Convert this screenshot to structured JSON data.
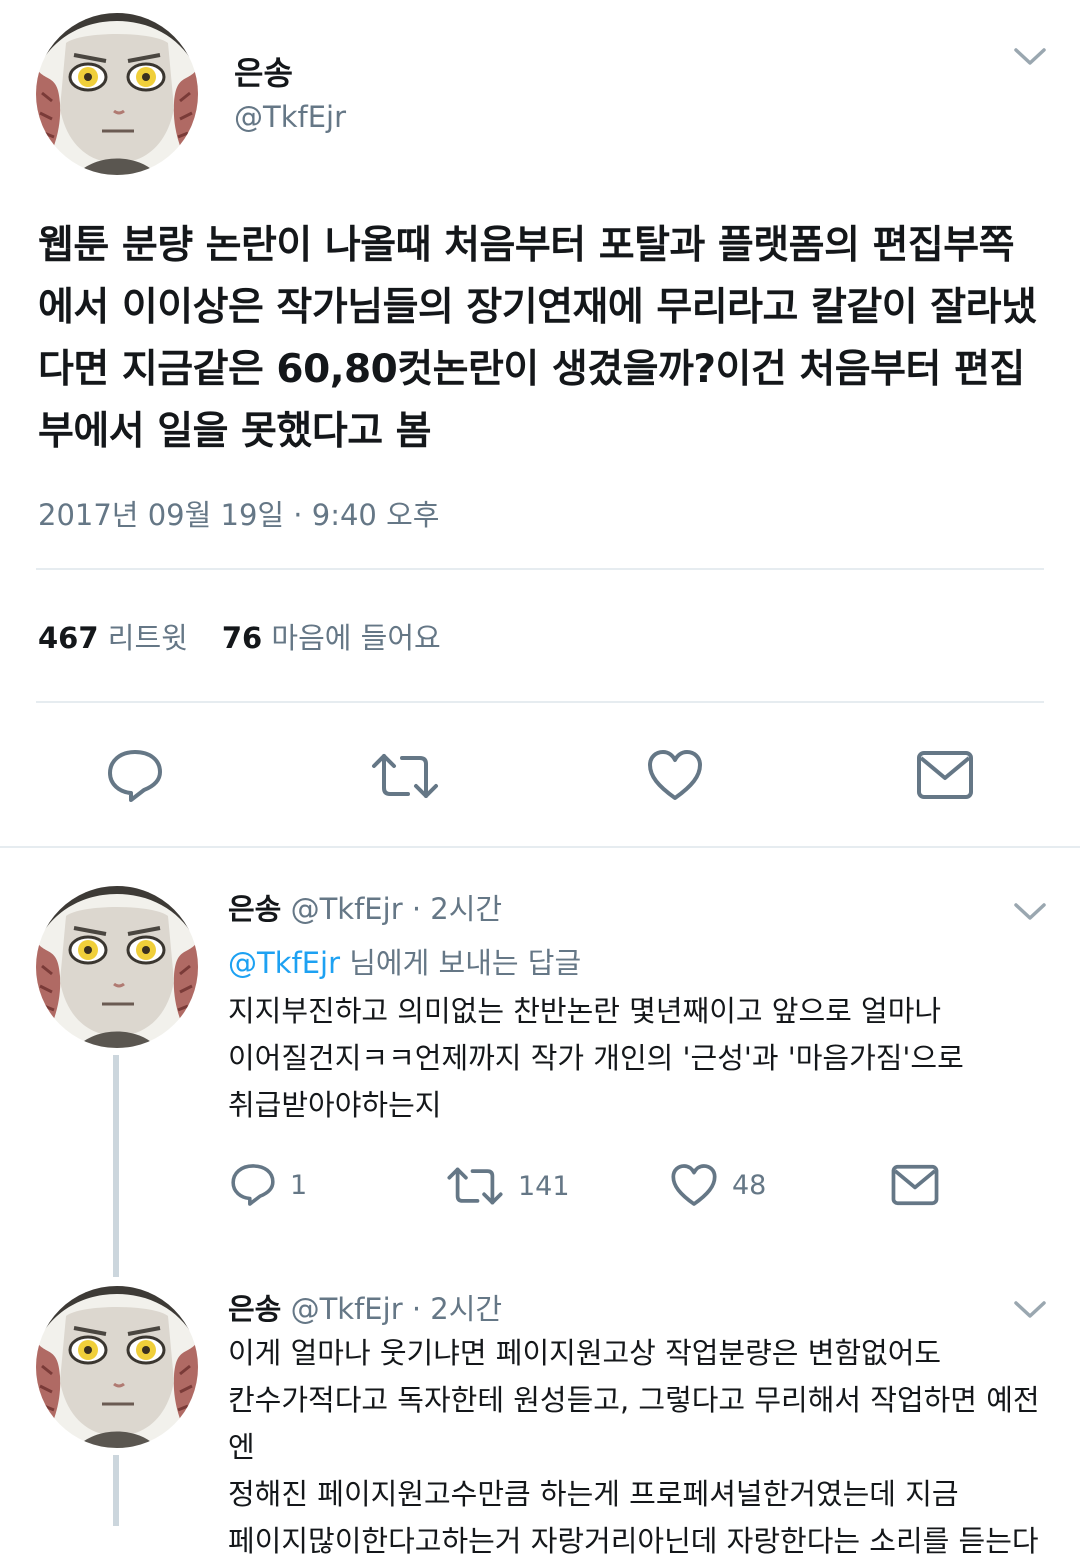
{
  "colors": {
    "accent": "#1da1f2",
    "text": "#14171a",
    "secondary": "#657786",
    "divider": "#e6ecf0"
  },
  "main_tweet": {
    "name": "은송",
    "handle": "@TkfEjr",
    "body": "웹툰 분량 논란이 나올때 처음부터 포탈과 플랫폼의 편집부쪽에서 이이상은 작가님들의 장기연재에 무리라고 칼같이 잘라냈다면 지금같은 60,80컷논란이 생겼을까?이건 처음부터 편집부에서 일을 못했다고 봄",
    "timestamp": "2017년 09월 19일 · 9:40 오후",
    "retweets_count": "467",
    "retweets_label": "리트윗",
    "likes_count": "76",
    "likes_label": "마음에 들어요",
    "icons": {
      "reply": "reply-icon",
      "retweet": "retweet-icon",
      "like": "heart-icon",
      "message": "mail-icon",
      "menu": "chevron-down-icon"
    }
  },
  "replies": [
    {
      "name": "은송",
      "handle": "@TkfEjr",
      "time": "· 2시간",
      "reply_to_handle": "@TkfEjr",
      "reply_to_suffix": "님에게 보내는 답글",
      "body_lines": [
        "지지부진하고 의미없는 찬반논란 몇년째이고 앞으로 얼마나",
        "이어질건지ㅋㅋ언제까지 작가 개인의 '근성'과 '마음가짐'으로",
        "취급받아야하는지"
      ],
      "reply_count": "1",
      "retweet_count": "141",
      "like_count": "48"
    },
    {
      "name": "은송",
      "handle": "@TkfEjr",
      "time": "· 2시간",
      "body_lines": [
        "이게 얼마나 웃기냐면 페이지원고상 작업분량은 변함없어도",
        "칸수가적다고 독자한테 원성듣고, 그렇다고 무리해서 작업하면 예전엔",
        "정해진 페이지원고수만큼 하는게 프로페셔널한거였는데 지금",
        "페이지많이한다고하는거 자랑거리아닌데 자랑한다는 소리를 듣는다"
      ]
    }
  ]
}
